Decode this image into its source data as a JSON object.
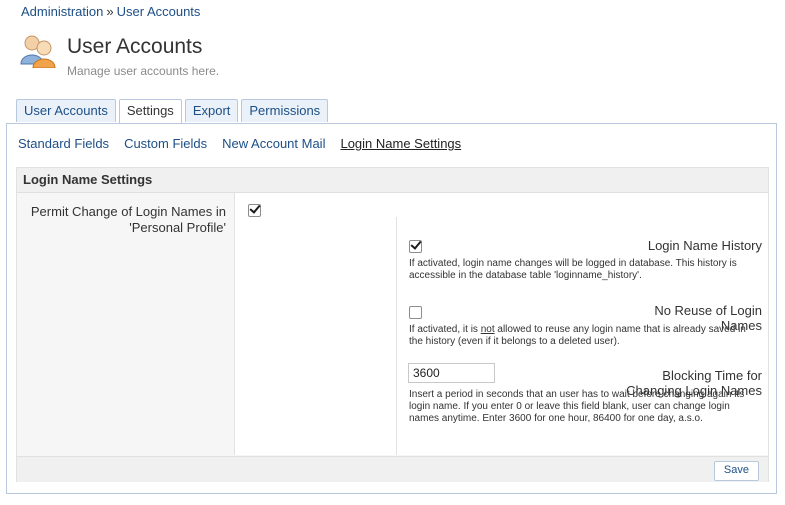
{
  "breadcrumb": {
    "parent": "Administration",
    "separator": "»",
    "current": "User Accounts"
  },
  "header": {
    "title": "User Accounts",
    "subtitle": "Manage user accounts here.",
    "icon": "users-icon"
  },
  "tabs": [
    {
      "label": "User Accounts",
      "active": false
    },
    {
      "label": "Settings",
      "active": true
    },
    {
      "label": "Export",
      "active": false
    },
    {
      "label": "Permissions",
      "active": false
    }
  ],
  "subnav": [
    {
      "label": "Standard Fields",
      "current": false
    },
    {
      "label": "Custom Fields",
      "current": false
    },
    {
      "label": "New Account Mail",
      "current": false
    },
    {
      "label": "Login Name Settings",
      "current": true
    }
  ],
  "section": {
    "title": "Login Name Settings",
    "permit_change": {
      "label": "Permit Change of Login Names in 'Personal Profile'",
      "checked": true
    },
    "history": {
      "label": "Login Name History",
      "checked": true,
      "help": "If activated, login name changes will be logged in database. This history is accessible in the database table 'loginname_history'."
    },
    "no_reuse": {
      "label": "No Reuse of Login Names",
      "checked": false,
      "help_before": "If activated, it is ",
      "help_emph": "not",
      "help_after": " allowed to reuse any login name that is already saved in the history (even if it belongs to a deleted user)."
    },
    "blocking_time": {
      "label": "Blocking Time for Changing Login Names",
      "value": "3600",
      "help": "Insert a period in seconds that an user has to wait before changing again its login name. If you enter 0 or leave this field blank, user can change login names anytime. Enter 3600 for one hour, 86400 for one day, a.s.o."
    }
  },
  "save_label": "Save",
  "colors": {
    "link": "#1d4f86",
    "border": "#b8c9de",
    "panel_bg": "#f6f6f6"
  }
}
